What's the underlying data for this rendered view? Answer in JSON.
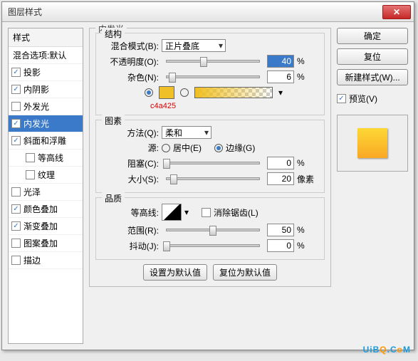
{
  "title": "图层样式",
  "sidebar": {
    "header": "样式",
    "sub": "混合选项:默认",
    "items": [
      {
        "label": "投影",
        "checked": true,
        "active": false,
        "indent": false
      },
      {
        "label": "内阴影",
        "checked": true,
        "active": false,
        "indent": false
      },
      {
        "label": "外发光",
        "checked": false,
        "active": false,
        "indent": false
      },
      {
        "label": "内发光",
        "checked": true,
        "active": true,
        "indent": false
      },
      {
        "label": "斜面和浮雕",
        "checked": true,
        "active": false,
        "indent": false
      },
      {
        "label": "等高线",
        "checked": false,
        "active": false,
        "indent": true
      },
      {
        "label": "纹理",
        "checked": false,
        "active": false,
        "indent": true
      },
      {
        "label": "光泽",
        "checked": false,
        "active": false,
        "indent": false
      },
      {
        "label": "颜色叠加",
        "checked": true,
        "active": false,
        "indent": false
      },
      {
        "label": "渐变叠加",
        "checked": true,
        "active": false,
        "indent": false
      },
      {
        "label": "图案叠加",
        "checked": false,
        "active": false,
        "indent": false
      },
      {
        "label": "描边",
        "checked": false,
        "active": false,
        "indent": false
      }
    ]
  },
  "panel_title": "内发光",
  "structure": {
    "title": "结构",
    "blend_label": "混合模式(B):",
    "blend_value": "正片叠底",
    "opacity_label": "不透明度(O):",
    "opacity_value": "40",
    "opacity_unit": "%",
    "noise_label": "杂色(N):",
    "noise_value": "6",
    "noise_unit": "%",
    "swatch_color": "#f0c028",
    "annotation": "c4a425"
  },
  "elements": {
    "title": "图素",
    "method_label": "方法(Q):",
    "method_value": "柔和",
    "source_label": "源:",
    "source_center": "居中(E)",
    "source_edge": "边缘(G)",
    "choke_label": "阻塞(C):",
    "choke_value": "0",
    "choke_unit": "%",
    "size_label": "大小(S):",
    "size_value": "20",
    "size_unit": "像素"
  },
  "quality": {
    "title": "品质",
    "contour_label": "等高线:",
    "antialias_label": "消除锯齿(L)",
    "range_label": "范围(R):",
    "range_value": "50",
    "range_unit": "%",
    "jitter_label": "抖动(J):",
    "jitter_value": "0",
    "jitter_unit": "%"
  },
  "bottom": {
    "set_default": "设置为默认值",
    "reset_default": "复位为默认值"
  },
  "right": {
    "ok": "确定",
    "cancel": "复位",
    "new_style": "新建样式(W)...",
    "preview": "预览(V)"
  },
  "watermark": {
    "u": "U",
    "i": "i",
    "b": "B",
    "q": "Q",
    "dot": ".",
    "c": "C",
    "m": "M"
  }
}
